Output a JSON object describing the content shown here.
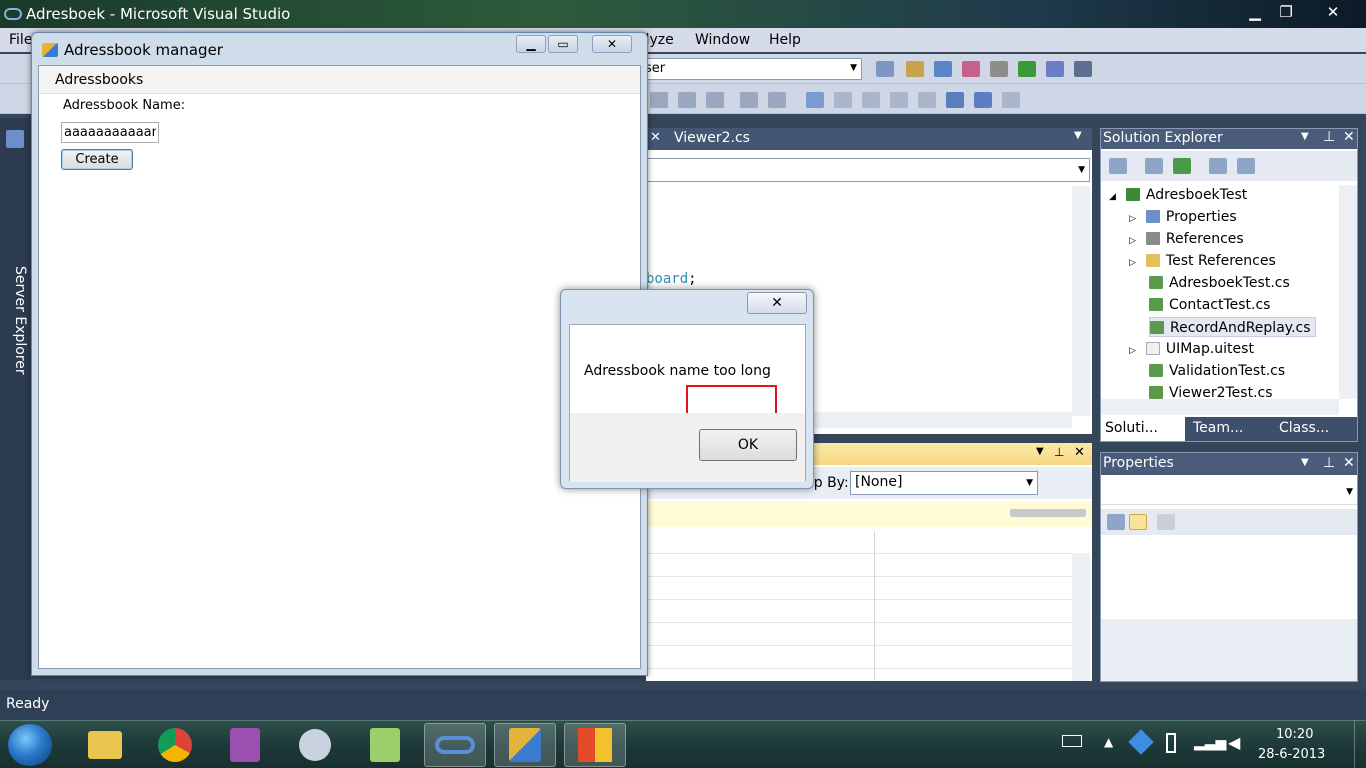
{
  "vs": {
    "title": "Adresboek - Microsoft Visual Studio",
    "menu_partial_left": "File",
    "menu_visible": [
      "alyze",
      "Window",
      "Help"
    ],
    "user_combo": "ser",
    "editor_tab": "Viewer2.cs",
    "code_fragment_1": "board",
    "code_fragment_2": ";",
    "group_by_label": "Group By:",
    "group_by_value": "[None]",
    "status": "Ready",
    "server_explorer": "Server Explorer"
  },
  "solution_explorer": {
    "title": "Solution Explorer",
    "items": [
      {
        "label": "AdresboekTest",
        "expander": "◢",
        "icon_color": "#3a8a3a"
      },
      {
        "label": "Properties",
        "expander": "▷",
        "icon_color": "#6b8fc7"
      },
      {
        "label": "References",
        "expander": "▷",
        "icon_color": "#8a8a8a"
      },
      {
        "label": "Test References",
        "expander": "▷",
        "icon_color": "#e3c15a"
      },
      {
        "label": "AdresboekTest.cs",
        "expander": "",
        "icon_color": "#5a9a4a"
      },
      {
        "label": "ContactTest.cs",
        "expander": "",
        "icon_color": "#5a9a4a"
      },
      {
        "label": "RecordAndReplay.cs",
        "expander": "",
        "icon_color": "#5a9a4a"
      },
      {
        "label": "UIMap.uitest",
        "expander": "▷",
        "icon_color": "#f0f0f0"
      },
      {
        "label": "ValidationTest.cs",
        "expander": "",
        "icon_color": "#5a9a4a"
      },
      {
        "label": "Viewer2Test.cs",
        "expander": "",
        "icon_color": "#5a9a4a"
      }
    ],
    "tabs": [
      "Soluti...",
      "Team...",
      "Class..."
    ]
  },
  "properties": {
    "title": "Properties"
  },
  "app": {
    "title": "Adressbook manager",
    "tab": "Adressbooks",
    "name_label": "Adressbook Name:",
    "name_value": "aaaaaaaaaaam",
    "create_button": "Create"
  },
  "msgbox": {
    "text": "Adressbook name too long",
    "ok_button": "OK"
  },
  "taskbar": {
    "time": "10:20",
    "date": "28-6-2013"
  },
  "colors": {
    "accent": "#2a5fa8",
    "highlight_red": "#e01515"
  }
}
